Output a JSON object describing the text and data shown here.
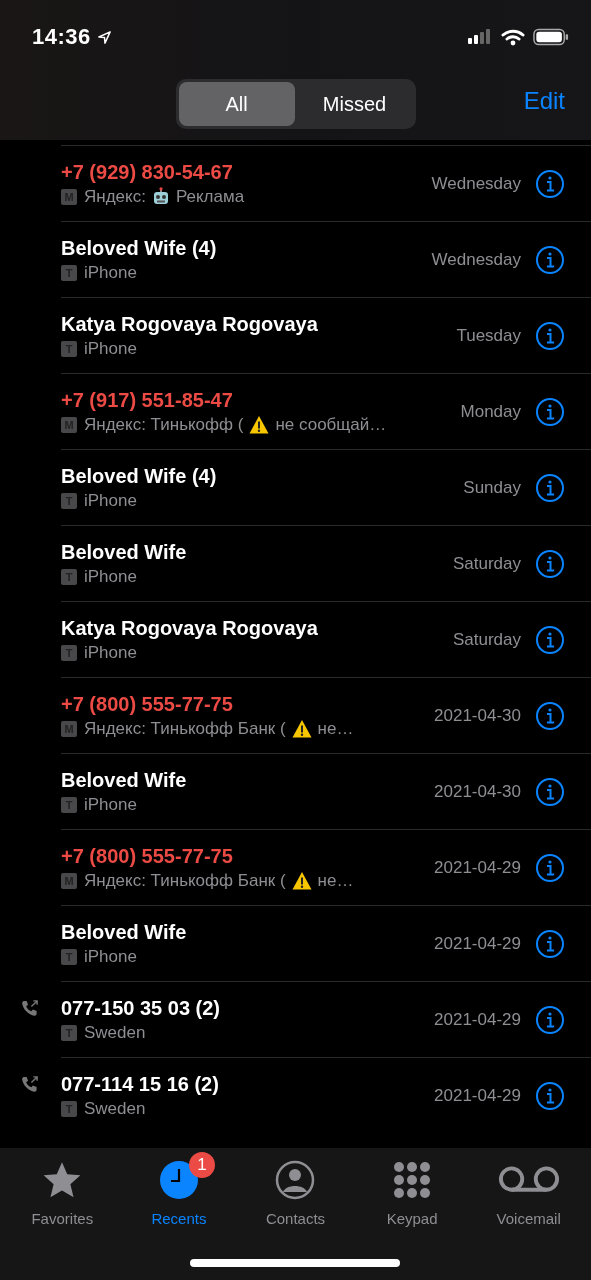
{
  "status_bar": {
    "time": "14:36"
  },
  "filter_tabs": [
    {
      "label": "All",
      "selected": true
    },
    {
      "label": "Missed",
      "selected": false
    }
  ],
  "edit_button": "Edit",
  "calls": [
    {
      "name": "+7 (929) 830-54-67",
      "missed": true,
      "outgoing": false,
      "line": "M",
      "detail": "Яндекс:",
      "emoji": {
        "kind": "robot"
      },
      "detail_end": "Реклама",
      "date": "Wednesday"
    },
    {
      "name": "Beloved Wife (4)",
      "missed": false,
      "outgoing": false,
      "line": "T",
      "detail": "iPhone",
      "date": "Wednesday"
    },
    {
      "name": "Katya Rogovaya Rogovaya",
      "missed": false,
      "outgoing": false,
      "line": "T",
      "detail": "iPhone",
      "date": "Tuesday"
    },
    {
      "name": "+7 (917) 551-85-47",
      "missed": true,
      "outgoing": false,
      "line": "M",
      "detail": "Яндекс: Тинькофф (",
      "emoji": {
        "kind": "warning"
      },
      "detail_end": "не сообщай…",
      "date": "Monday"
    },
    {
      "name": "Beloved Wife (4)",
      "missed": false,
      "outgoing": false,
      "line": "T",
      "detail": "iPhone",
      "date": "Sunday"
    },
    {
      "name": "Beloved Wife",
      "missed": false,
      "outgoing": false,
      "line": "T",
      "detail": "iPhone",
      "date": "Saturday"
    },
    {
      "name": "Katya Rogovaya Rogovaya",
      "missed": false,
      "outgoing": false,
      "line": "T",
      "detail": "iPhone",
      "date": "Saturday"
    },
    {
      "name": "+7 (800) 555-77-75",
      "missed": true,
      "outgoing": false,
      "line": "M",
      "detail": "Яндекс: Тинькофф Банк (",
      "emoji": {
        "kind": "warning"
      },
      "detail_end": "не…",
      "date": "2021-04-30"
    },
    {
      "name": "Beloved Wife",
      "missed": false,
      "outgoing": false,
      "line": "T",
      "detail": "iPhone",
      "date": "2021-04-30"
    },
    {
      "name": "+7 (800) 555-77-75",
      "missed": true,
      "outgoing": false,
      "line": "M",
      "detail": "Яндекс: Тинькофф Банк (",
      "emoji": {
        "kind": "warning"
      },
      "detail_end": "не…",
      "date": "2021-04-29"
    },
    {
      "name": "Beloved Wife",
      "missed": false,
      "outgoing": false,
      "line": "T",
      "detail": "iPhone",
      "date": "2021-04-29"
    },
    {
      "name": "077-150 35 03 (2)",
      "missed": false,
      "outgoing": true,
      "line": "T",
      "detail": "Sweden",
      "date": "2021-04-29"
    },
    {
      "name": "077-114 15 16 (2)",
      "missed": false,
      "outgoing": true,
      "line": "T",
      "detail": "Sweden",
      "date": "2021-04-29"
    }
  ],
  "tab_bar": [
    {
      "kind": "favorites",
      "label": "Favorites",
      "selected": false
    },
    {
      "kind": "recents",
      "label": "Recents",
      "selected": true,
      "badge": "1"
    },
    {
      "kind": "contacts",
      "label": "Contacts",
      "selected": false
    },
    {
      "kind": "keypad",
      "label": "Keypad",
      "selected": false
    },
    {
      "kind": "voicemail",
      "label": "Voicemail",
      "selected": false
    }
  ]
}
